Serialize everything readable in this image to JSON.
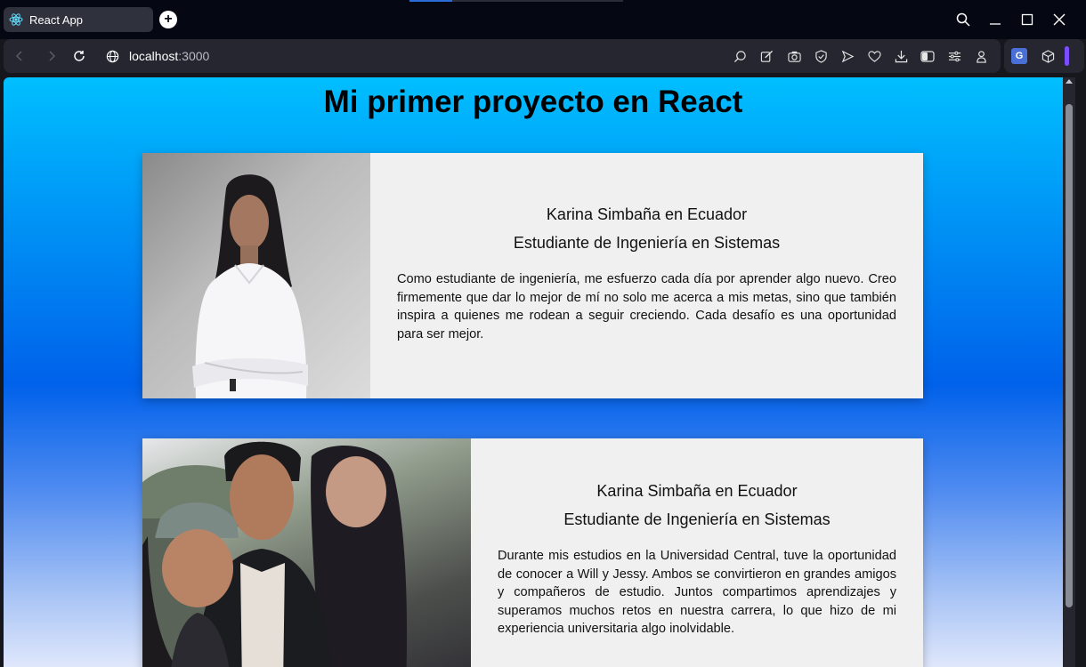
{
  "browser": {
    "tab_title": "React App",
    "url_host": "localhost",
    "url_port": ":3000",
    "new_tab_symbol": "+",
    "extension_translate_label": "G"
  },
  "page": {
    "title": "Mi primer proyecto en React"
  },
  "cards": [
    {
      "name": "Karina Simbaña en Ecuador",
      "role": "Estudiante de Ingeniería en Sistemas",
      "description": "Como estudiante de ingeniería, me esfuerzo cada día por aprender algo nuevo. Creo firmemente que dar lo mejor de mí no solo me acerca a mis metas, sino que también inspira a quienes me rodean a seguir creciendo. Cada desafío es una oportunidad para ser mejor."
    },
    {
      "name": "Karina Simbaña en Ecuador",
      "role": "Estudiante de Ingeniería en Sistemas",
      "description": "Durante mis estudios en la Universidad Central, tuve la oportunidad de conocer a Will y Jessy. Ambos se convirtieron en grandes amigos y compañeros de estudio. Juntos compartimos aprendizajes y superamos muchos retos en nuestra carrera, lo que hizo de mi experiencia universitaria algo inolvidable."
    }
  ],
  "colors": {
    "gradient_top": "#00bfff",
    "gradient_mid": "#0061ea",
    "gradient_bottom": "#dfe7fb",
    "card_background": "#f0f0f0",
    "titlebar": "#050812",
    "toolbar": "#25262f"
  }
}
